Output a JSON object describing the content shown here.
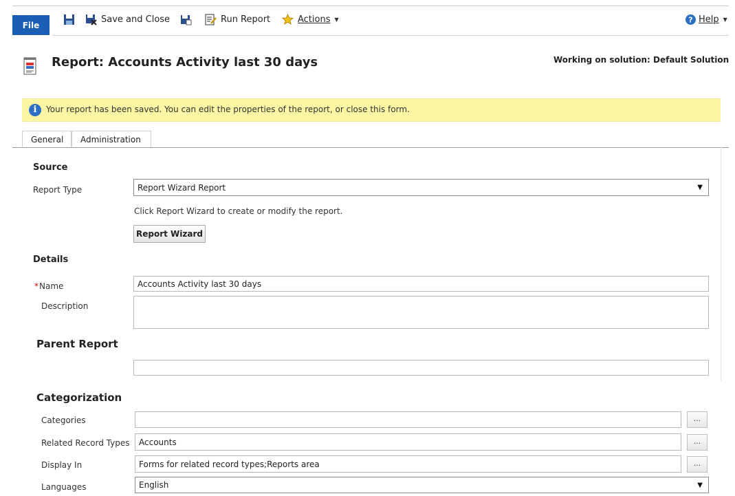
{
  "toolbar": {
    "file_label": "File",
    "save_and_close_label": "Save and Close",
    "run_report_label": "Run Report",
    "actions_label": "Actions",
    "help_label": "Help"
  },
  "header": {
    "title": "Report: Accounts Activity last 30 days",
    "solution": "Working on solution: Default Solution"
  },
  "notification": {
    "icon": "info-icon",
    "text": "Your report has been saved. You can edit the properties of the report, or close this form."
  },
  "tabs": [
    {
      "label": "General"
    },
    {
      "label": "Administration"
    }
  ],
  "source": {
    "heading": "Source",
    "report_type_label": "Report Type",
    "report_type_value": "Report Wizard Report",
    "hint": "Click Report Wizard to create or modify the report.",
    "wizard_button": "Report Wizard"
  },
  "details": {
    "heading": "Details",
    "name_label": "Name",
    "name_value": "Accounts Activity last 30 days",
    "description_label": "Description",
    "description_value": ""
  },
  "parent": {
    "heading": "Parent Report",
    "value": ""
  },
  "categorization": {
    "heading": "Categorization",
    "categories_label": "Categories",
    "categories_value": "",
    "related_label": "Related Record Types",
    "related_value": "Accounts",
    "display_label": "Display In",
    "display_value": "Forms for related record types;Reports area",
    "languages_label": "Languages",
    "languages_value": "English",
    "lookup_button": "..."
  },
  "colors": {
    "file_button": "#1a5fb4",
    "notification_bg": "#fbf6a4",
    "info_icon": "#2c6fc5",
    "required_marker": "#cc0000"
  }
}
